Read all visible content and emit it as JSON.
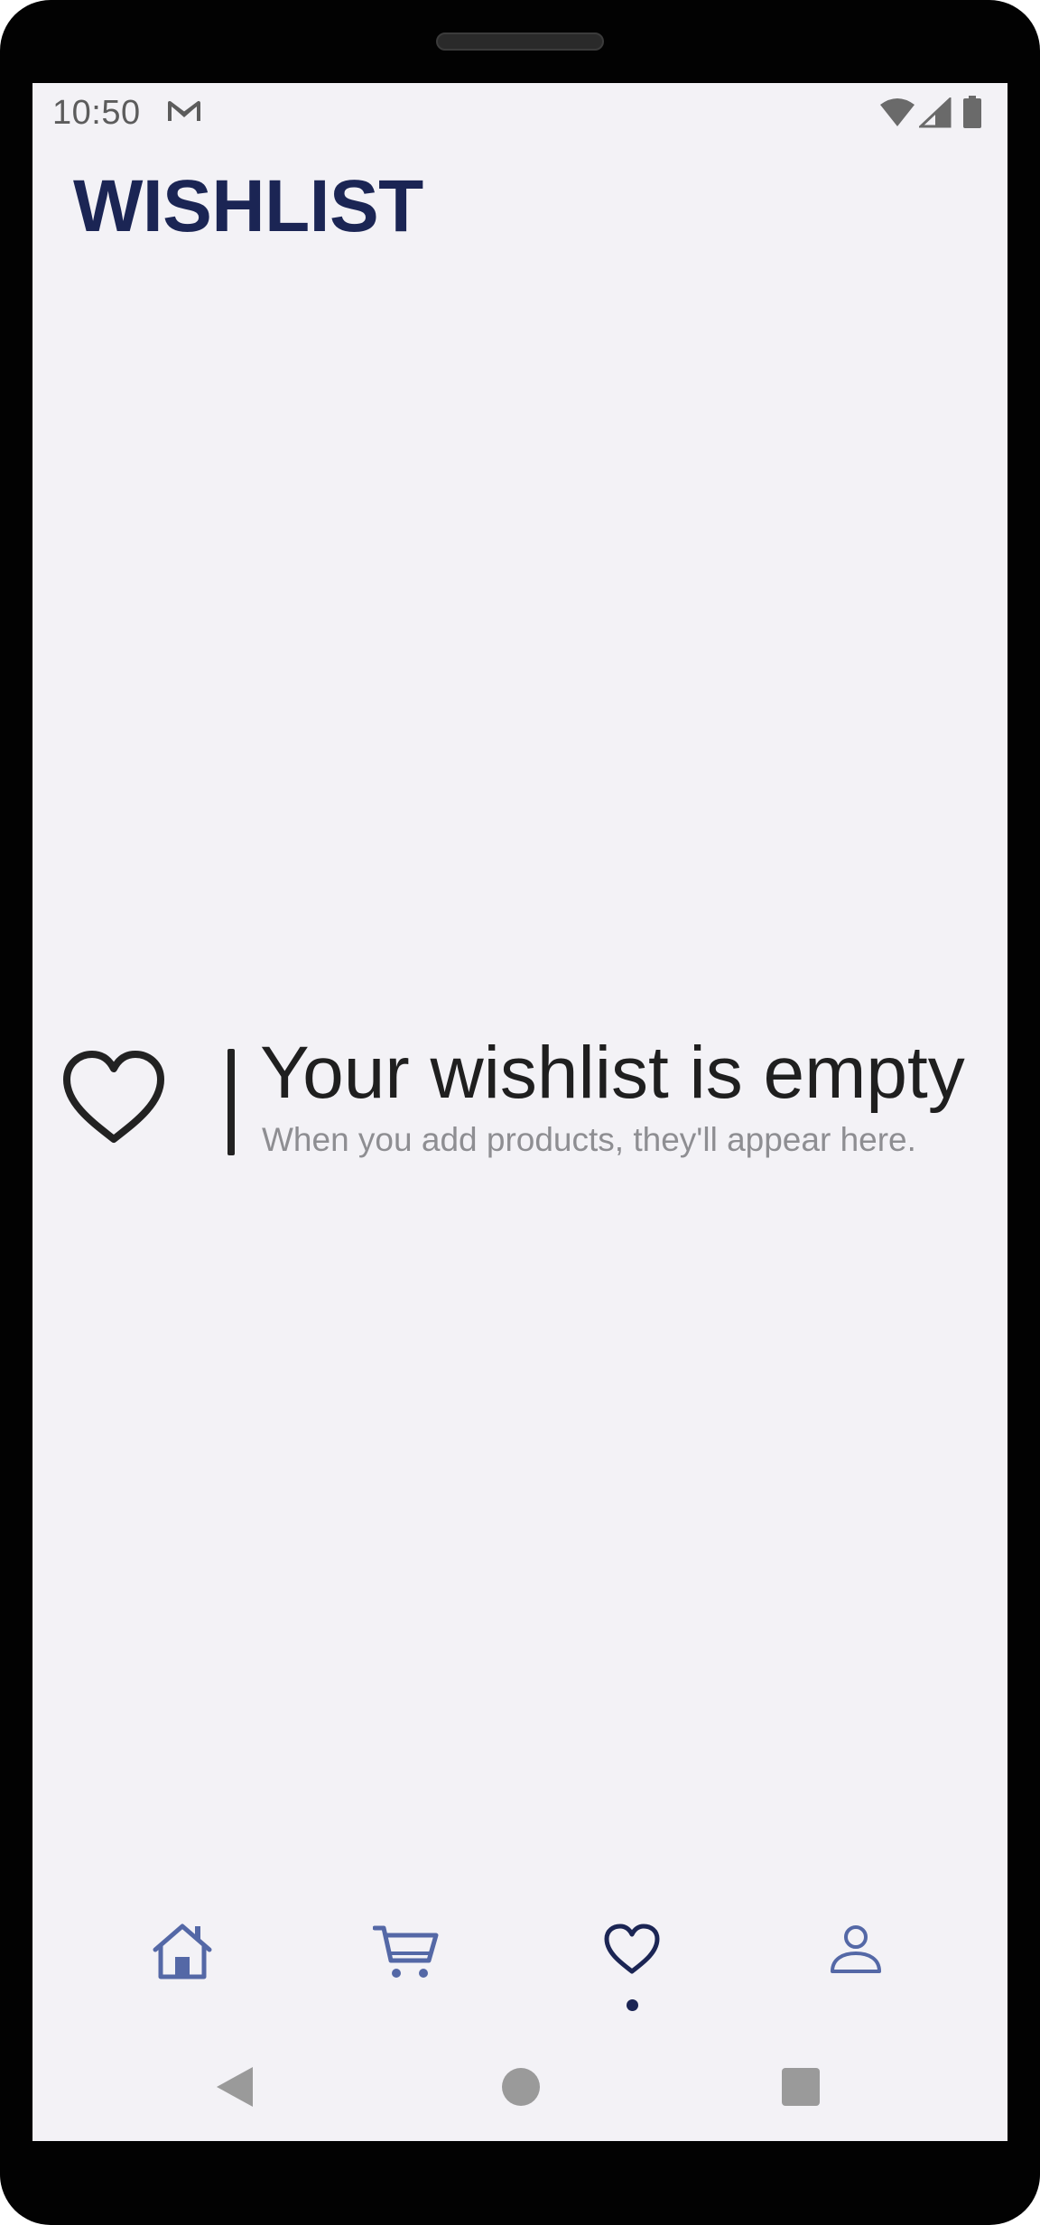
{
  "status_bar": {
    "time": "10:50",
    "notification_icon": "gmail-icon",
    "icons": [
      "wifi-icon",
      "signal-icon",
      "battery-icon"
    ]
  },
  "header": {
    "title": "WISHLIST"
  },
  "empty_state": {
    "icon": "heart-outline-icon",
    "title": "Your wishlist is empty",
    "subtitle": "When you add products, they'll appear here."
  },
  "bottom_nav": {
    "items": [
      {
        "name": "home",
        "icon": "home-icon",
        "active": false
      },
      {
        "name": "cart",
        "icon": "cart-icon",
        "active": false
      },
      {
        "name": "wishlist",
        "icon": "heart-icon",
        "active": true
      },
      {
        "name": "profile",
        "icon": "user-icon",
        "active": false
      }
    ]
  },
  "system_nav": {
    "buttons": [
      "back-icon",
      "home-circle-icon",
      "recents-square-icon"
    ]
  },
  "colors": {
    "background": "#f3f2f6",
    "title": "#1b2554",
    "nav_inactive": "#5468a6",
    "nav_active": "#1b2554",
    "empty_title": "#1f1f1f",
    "empty_subtitle": "#8e8e92"
  }
}
